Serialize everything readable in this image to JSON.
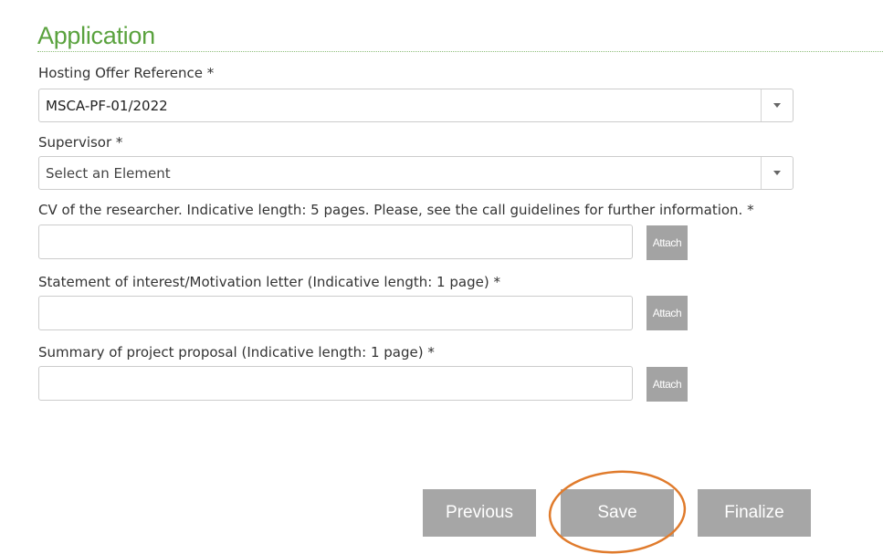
{
  "section": {
    "title": "Application"
  },
  "fields": {
    "hosting_offer": {
      "label": "Hosting Offer Reference *",
      "value": "MSCA-PF-01/2022"
    },
    "supervisor": {
      "label": "Supervisor *",
      "placeholder": "Select an Element"
    },
    "cv": {
      "label": "CV of the researcher. Indicative length: 5 pages. Please, see the call guidelines for further information. *",
      "attach_label": "Attach"
    },
    "statement": {
      "label": "Statement of interest/Motivation letter (Indicative length: 1 page) *",
      "attach_label": "Attach"
    },
    "summary": {
      "label": "Summary of project proposal (Indicative length: 1 page) *",
      "attach_label": "Attach"
    }
  },
  "actions": {
    "previous_label": "Previous",
    "save_label": "Save",
    "finalize_label": "Finalize"
  },
  "icons": {
    "dropdown": "caret-down-icon"
  },
  "colors": {
    "title": "#5aa23e",
    "button": "#a6a6a6",
    "highlight": "#e07b2c"
  }
}
